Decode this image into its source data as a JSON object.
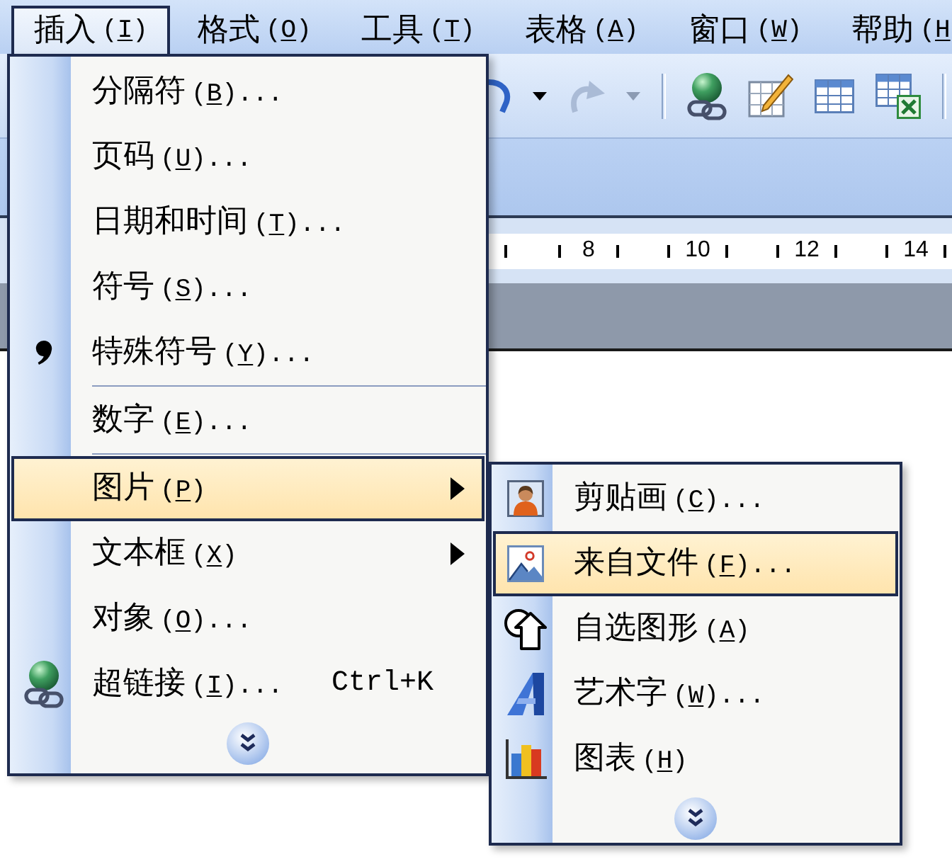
{
  "menubar": [
    {
      "label": "插入",
      "access": [
        "(",
        "I",
        ")"
      ],
      "selected": true
    },
    {
      "label": "格式",
      "access": [
        "(",
        "O",
        ")"
      ],
      "selected": false
    },
    {
      "label": "工具",
      "access": [
        "(",
        "T",
        ")"
      ],
      "selected": false
    },
    {
      "label": "表格",
      "access": [
        "(",
        "A",
        ")"
      ],
      "selected": false
    },
    {
      "label": "窗口",
      "access": [
        "(",
        "W",
        ")"
      ],
      "selected": false
    },
    {
      "label": "帮助",
      "access": [
        "(",
        "H"
      ],
      "selected": false
    }
  ],
  "toolbar": [
    {
      "kind": "undo",
      "disabled": false
    },
    {
      "kind": "redo",
      "disabled": true
    },
    {
      "kind": "separator"
    },
    {
      "kind": "hyperlink"
    },
    {
      "kind": "drawtable"
    },
    {
      "kind": "table"
    },
    {
      "kind": "sheet"
    },
    {
      "kind": "separator"
    }
  ],
  "ruler": {
    "labels": [
      "8",
      "10",
      "12",
      "14"
    ]
  },
  "menu": {
    "items": [
      {
        "kind": "command",
        "label": "分隔符",
        "access": [
          "(",
          "B",
          ")"
        ],
        "suffix": "...",
        "selected": false
      },
      {
        "kind": "command",
        "label": "页码",
        "access": [
          "(",
          "U",
          ")"
        ],
        "suffix": "...",
        "selected": false
      },
      {
        "kind": "command",
        "label": "日期和时间",
        "access": [
          "(",
          "T",
          ")"
        ],
        "suffix": "...",
        "selected": false
      },
      {
        "kind": "command",
        "label": "符号",
        "access": [
          "(",
          "S",
          ")"
        ],
        "suffix": "...",
        "selected": false
      },
      {
        "kind": "command",
        "label": "特殊符号",
        "access": [
          "(",
          "Y",
          ")"
        ],
        "suffix": "...",
        "selected": false
      },
      {
        "kind": "separator"
      },
      {
        "kind": "command",
        "label": "数字",
        "access": [
          "(",
          "E",
          ")"
        ],
        "suffix": "...",
        "selected": false
      },
      {
        "kind": "separator"
      },
      {
        "kind": "submenu",
        "label": "图片",
        "access": [
          "(",
          "P",
          ")"
        ],
        "selected": true,
        "children": [
          {
            "kind": "command",
            "label": "剪贴画",
            "access": [
              "(",
              "C",
              ")"
            ],
            "suffix": "...",
            "selected": false
          },
          {
            "kind": "command",
            "label": "来自文件",
            "access": [
              "(",
              "F",
              ")"
            ],
            "suffix": "...",
            "selected": true
          },
          {
            "kind": "command",
            "label": "自选图形",
            "access": [
              "(",
              "A",
              ")"
            ],
            "selected": false
          },
          {
            "kind": "command",
            "label": "艺术字",
            "access": [
              "(",
              "W",
              ")"
            ],
            "suffix": "...",
            "selected": false
          },
          {
            "kind": "command",
            "label": "图表",
            "access": [
              "(",
              "H",
              ")"
            ],
            "selected": false
          }
        ]
      },
      {
        "kind": "submenu",
        "label": "文本框",
        "access": [
          "(",
          "X",
          ")"
        ],
        "selected": false
      },
      {
        "kind": "command",
        "label": "对象",
        "access": [
          "(",
          "O",
          ")"
        ],
        "suffix": "...",
        "selected": false
      },
      {
        "kind": "command",
        "label": "超链接",
        "access": [
          "(",
          "I",
          ")"
        ],
        "suffix": "...",
        "shortcut": "Ctrl+K",
        "selected": false
      }
    ]
  }
}
